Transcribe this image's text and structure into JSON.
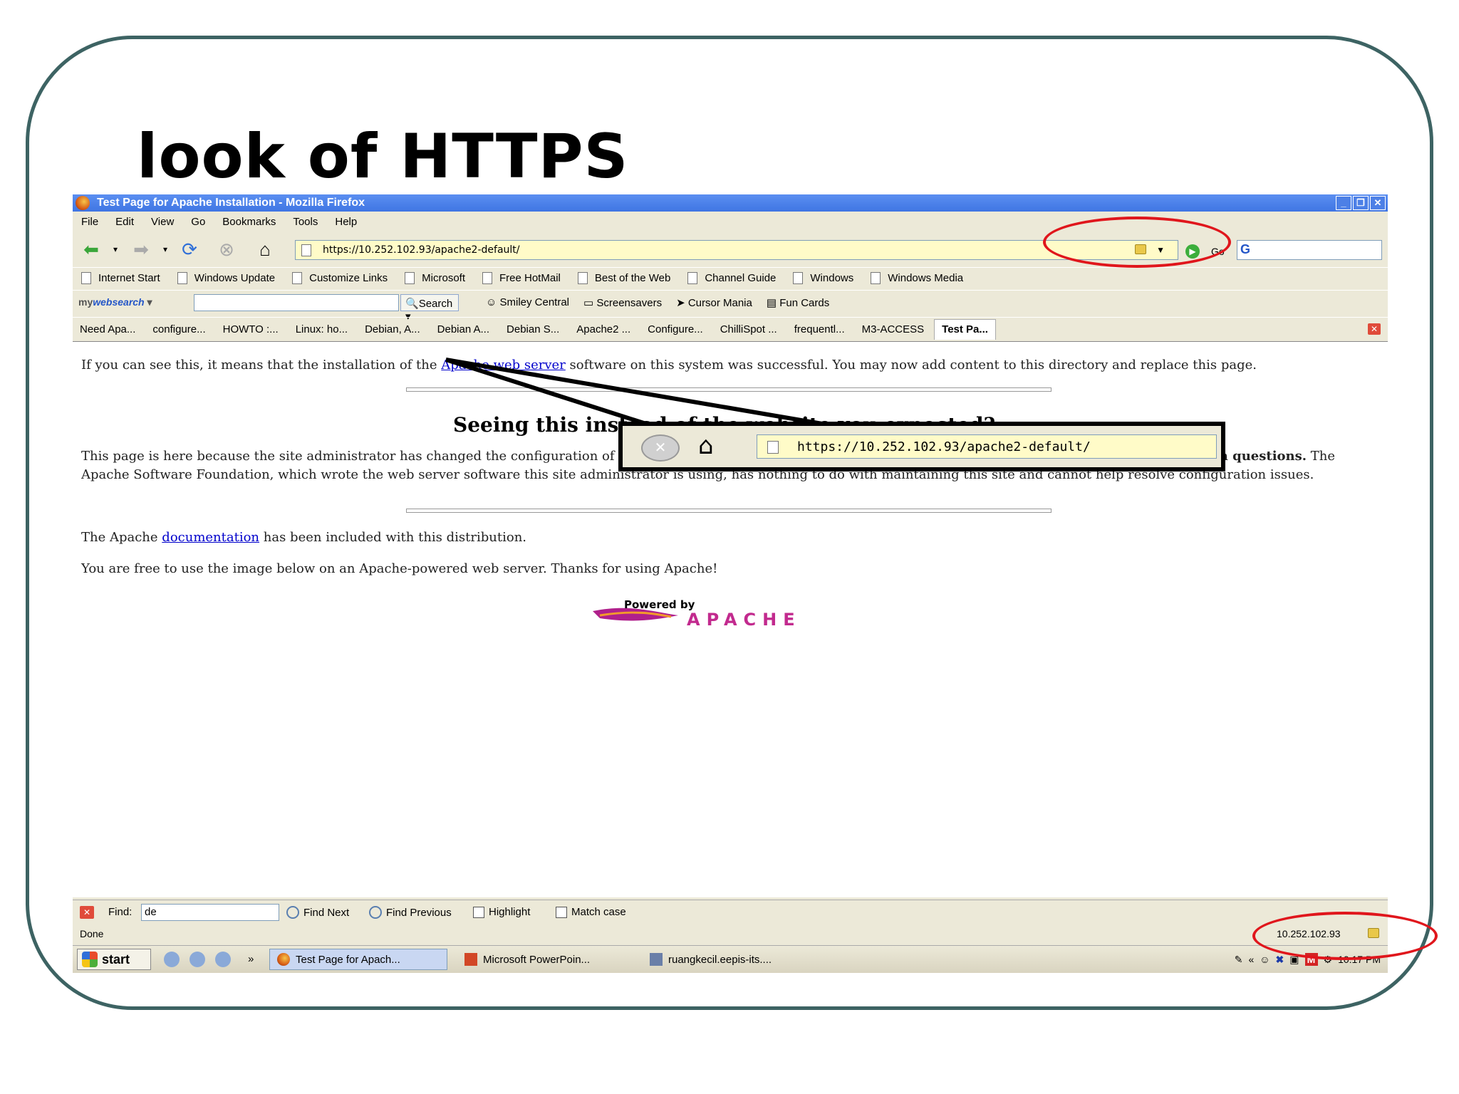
{
  "slide": {
    "title": "look of HTTPS"
  },
  "window": {
    "title": "Test Page for Apache Installation - Mozilla Firefox",
    "controls": [
      "_",
      "❐",
      "✕"
    ]
  },
  "menu": [
    "File",
    "Edit",
    "View",
    "Go",
    "Bookmarks",
    "Tools",
    "Help"
  ],
  "nav": {
    "url": "https://10.252.102.93/apache2-default/",
    "go_label": "Go",
    "search_engine_icon": "G"
  },
  "bookmarks": [
    "Internet Start",
    "Windows Update",
    "Customize Links",
    "Microsoft",
    "Free HotMail",
    "Best of the Web",
    "Channel Guide",
    "Windows",
    "Windows Media"
  ],
  "mywebsearch": {
    "logo_prefix": "my",
    "logo_brand": "websearch",
    "search_label": "Search",
    "links": [
      "Smiley Central",
      "Screensavers",
      "Cursor Mania",
      "Fun Cards"
    ]
  },
  "tabs": [
    "Need Apa...",
    "configure...",
    "HOWTO :...",
    "Linux: ho...",
    "Debian, A...",
    "Debian A...",
    "Debian S...",
    "Apache2 ...",
    "Configure...",
    "ChilliSpot ...",
    "frequentl...",
    "M3-ACCESS",
    "Test Pa..."
  ],
  "page": {
    "line1_pre": "If you can see this, it means that the installation of the",
    "line1_link": "Apache web server",
    "line1_post": "software on this system was successful. You may now add content to this directory and replace this page.",
    "heading": "Seeing this instead of the website you expected?",
    "para2a_pre": "This page is here because the site administrator has changed the configuration of this web server. Please",
    "para2a_bold": "contact the person responsible for maintaining this server with questions.",
    "para2a_post": "The",
    "para2b": "Apache Software Foundation, which wrote the web server software this site administrator is using, has nothing to do with maintaining this site and cannot help resolve configuration issues.",
    "doc_pre": "The Apache",
    "doc_link": "documentation",
    "doc_post": "has been included with this distribution.",
    "free": "You are free to use the image below on an Apache-powered web server. Thanks for using Apache!",
    "powered_by": "Powered by",
    "apache": "APACHE"
  },
  "callout": {
    "url": "https://10.252.102.93/apache2-default/"
  },
  "findbar": {
    "label": "Find:",
    "value": "de",
    "find_next": "Find Next",
    "find_previous": "Find Previous",
    "highlight": "Highlight",
    "match_case": "Match case"
  },
  "status": {
    "text": "Done",
    "host": "10.252.102.93"
  },
  "taskbar": {
    "start": "start",
    "chevron": "»",
    "items": [
      "Test Page for Apach...",
      "Microsoft PowerPoin...",
      "ruangkecil.eepis-its...."
    ],
    "clock": "10:17 PM"
  },
  "colors": {
    "frame": "#3d6363",
    "highlight_ring": "#e0161c",
    "titlebar": "#3f75e3",
    "url_bar_secure": "#fffbc8"
  }
}
